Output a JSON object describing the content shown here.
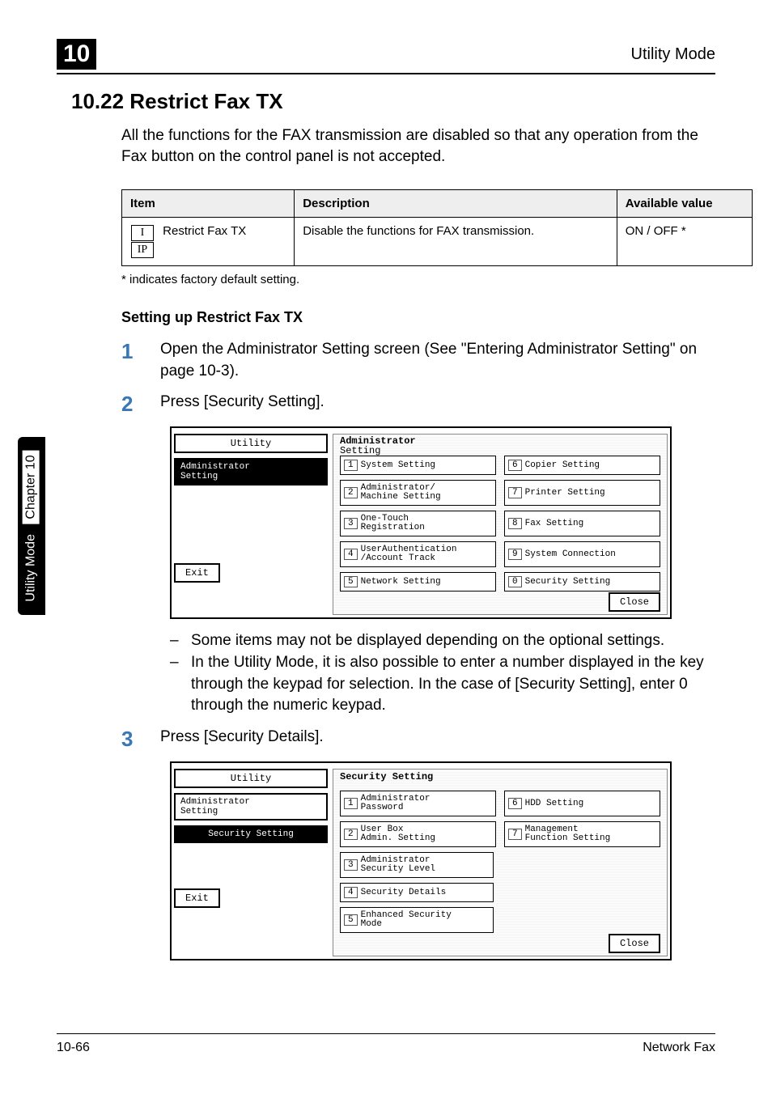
{
  "header": {
    "chapter_number": "10",
    "right_label": "Utility Mode"
  },
  "side_tab": {
    "mode_label": "Utility Mode",
    "chapter_label": "Chapter 10"
  },
  "section": {
    "number_title": "10.22  Restrict Fax TX",
    "intro": "All the functions for the FAX transmission are disabled so that any operation from the Fax button on the control panel is not accepted."
  },
  "table": {
    "head_item": "Item",
    "head_desc": "Description",
    "head_avail": "Available value",
    "row": {
      "icon1": "I",
      "icon2": "IP",
      "item": "Restrict Fax TX",
      "desc": "Disable the functions for FAX transmission.",
      "value": "ON / OFF *"
    }
  },
  "footnote": "* indicates factory default setting.",
  "sub_heading": "Setting up Restrict Fax TX",
  "steps": {
    "s1": {
      "num": "1",
      "text": "Open the Administrator Setting screen (See \"Entering Administrator Setting\" on page 10-3)."
    },
    "s2": {
      "num": "2",
      "text": "Press [Security Setting]."
    },
    "s3": {
      "num": "3",
      "text": "Press [Security Details]."
    }
  },
  "panel1": {
    "title_line1": "Administrator",
    "title_line2": "Setting",
    "left_tab1": "Utility",
    "left_tab2": "Administrator\nSetting",
    "btns": {
      "b1": "System Setting",
      "b2": "Administrator/\nMachine Setting",
      "b3": "One-Touch\nRegistration",
      "b4": "UserAuthentication\n/Account Track",
      "b5": "Network Setting",
      "b6": "Copier Setting",
      "b7": "Printer Setting",
      "b8": "Fax Setting",
      "b9": "System Connection",
      "b0": "Security Setting"
    },
    "exit": "Exit",
    "close": "Close"
  },
  "notes": {
    "n1": "Some items may not be displayed depending on the optional settings.",
    "n2": "In the Utility Mode, it is also possible to enter a number displayed in the key through the keypad for selection. In the case of [Security Setting], enter 0 through the numeric keypad."
  },
  "panel2": {
    "title": "Security Setting",
    "left_tab1": "Utility",
    "left_tab2": "Administrator\nSetting",
    "left_tab3": "Security Setting",
    "btns": {
      "b1": "Administrator\nPassword",
      "b2": "User Box\nAdmin. Setting",
      "b3": "Administrator\nSecurity Level",
      "b4": "Security Details",
      "b5": "Enhanced Security\nMode",
      "b6": "HDD Setting",
      "b7": "Management\nFunction Setting"
    },
    "exit": "Exit",
    "close": "Close"
  },
  "footer": {
    "left": "10-66",
    "right": "Network Fax"
  }
}
